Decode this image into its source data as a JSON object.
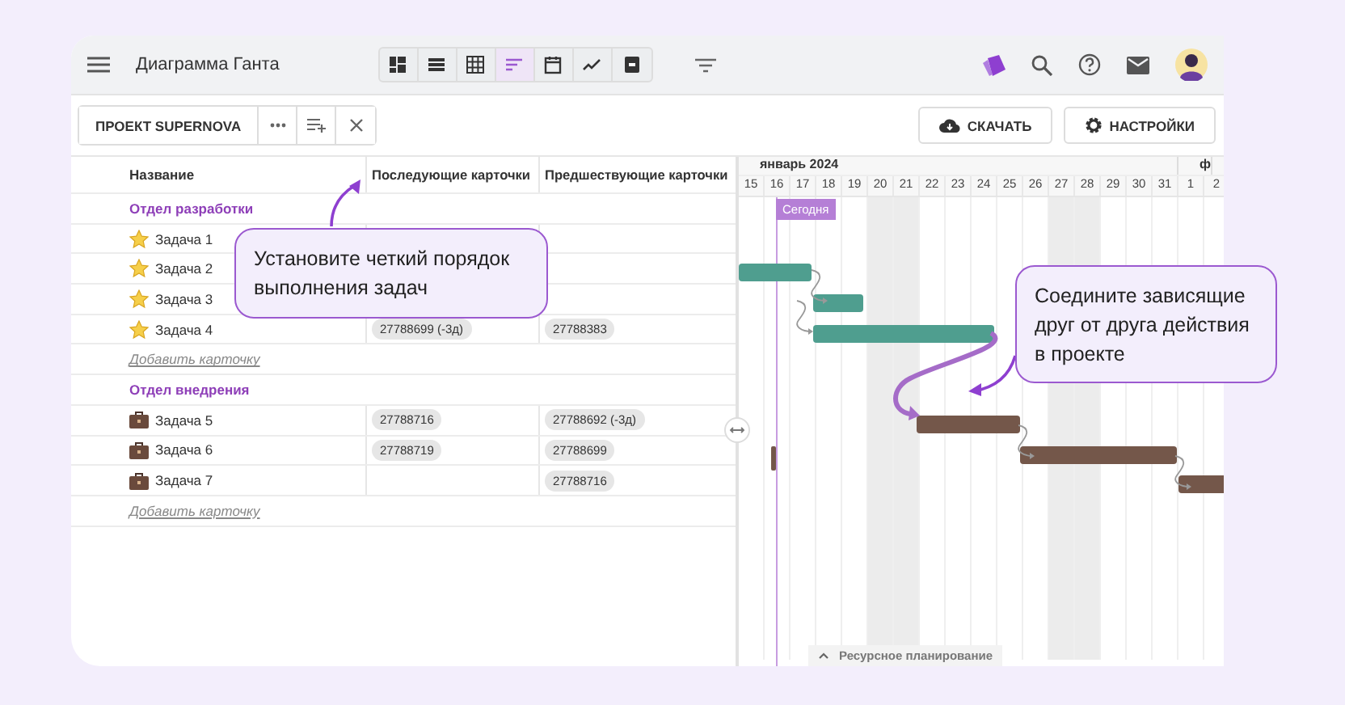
{
  "app_bar": {
    "title": "Диаграмма Ганта",
    "views": [
      {
        "kind": "dashboard",
        "selected": false
      },
      {
        "kind": "list",
        "selected": false
      },
      {
        "kind": "grid",
        "selected": false
      },
      {
        "kind": "gantt",
        "selected": true
      },
      {
        "kind": "calendar",
        "selected": false
      },
      {
        "kind": "chart",
        "selected": false
      },
      {
        "kind": "archive",
        "selected": false
      }
    ]
  },
  "toolbar": {
    "project": "ПРОЕКТ SUPERNOVA",
    "download": "СКАЧАТЬ",
    "settings": "НАСТРОЙКИ"
  },
  "table": {
    "columns": [
      "Название",
      "Последующие карточки",
      "Предшествующие карточки"
    ],
    "groups": [
      {
        "name": "Отдел разработки",
        "color": "#4f9e8f",
        "add_label": "Добавить карточку",
        "tasks": [
          {
            "name": "Задача 1",
            "kind": "star"
          },
          {
            "name": "Задача 2",
            "kind": "star"
          },
          {
            "name": "Задача 3",
            "kind": "star"
          },
          {
            "name": "Задача 4",
            "kind": "star",
            "successors": [
              "27788699 (-3д)"
            ],
            "predecessors": [
              "27788383"
            ]
          }
        ]
      },
      {
        "name": "Отдел внедрения",
        "color": "#74574a",
        "add_label": "Добавить карточку",
        "tasks": [
          {
            "name": "Задача 5",
            "kind": "briefcase",
            "successors": [
              "27788716"
            ],
            "predecessors": [
              "27788692 (-3д)"
            ]
          },
          {
            "name": "Задача 6",
            "kind": "briefcase",
            "successors": [
              "27788719"
            ],
            "predecessors": [
              "27788699"
            ]
          },
          {
            "name": "Задача 7",
            "kind": "briefcase",
            "predecessors": [
              "27788716"
            ]
          }
        ]
      }
    ]
  },
  "gantt": {
    "months": [
      "январь 2024",
      "ф"
    ],
    "days": [
      "15",
      "16",
      "17",
      "18",
      "19",
      "20",
      "21",
      "22",
      "23",
      "24",
      "25",
      "26",
      "27",
      "28",
      "29",
      "30",
      "31",
      "1",
      "2"
    ],
    "weekend": [
      false,
      false,
      false,
      false,
      false,
      true,
      true,
      false,
      false,
      false,
      false,
      false,
      true,
      true,
      false,
      false,
      false,
      false,
      false
    ],
    "today_label": "Сегодня",
    "resource_tab": "Ресурсное планирование"
  },
  "callouts": [
    "Установите четкий порядок выполнения задач",
    "Соедините зависящие друг от друга действия в проекте"
  ]
}
